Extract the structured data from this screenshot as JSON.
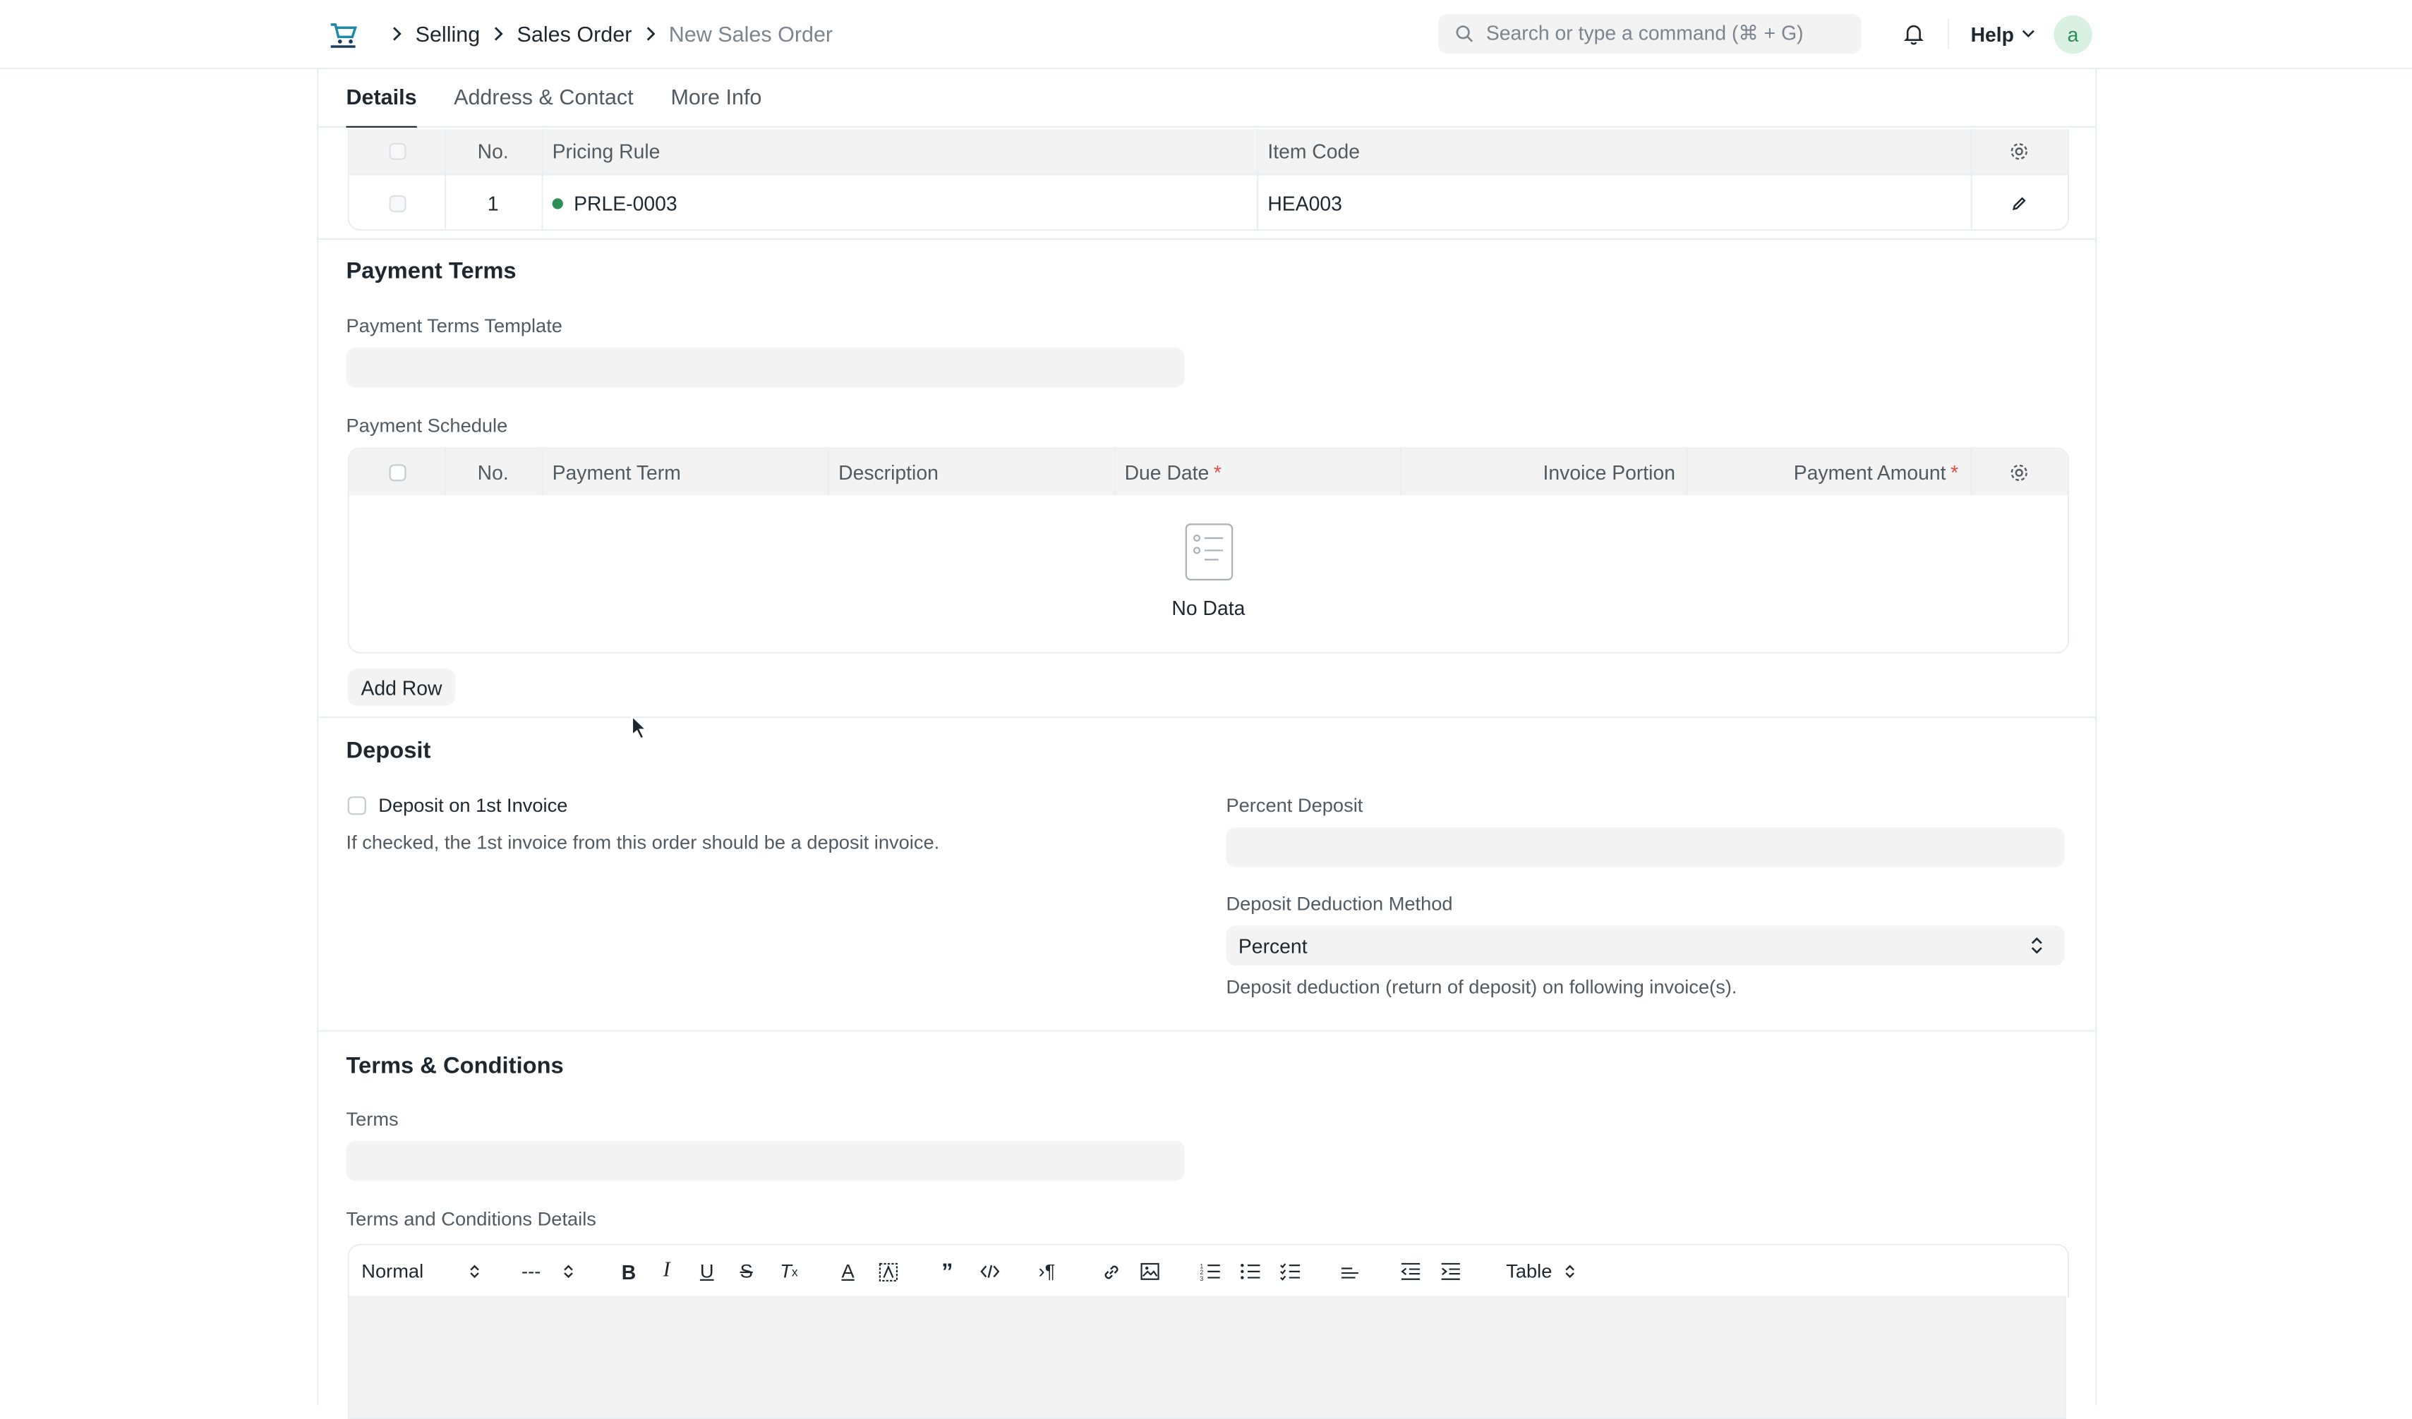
{
  "navbar": {
    "breadcrumbs": [
      "Selling",
      "Sales Order",
      "New Sales Order"
    ],
    "search_placeholder": "Search or type a command (⌘ + G)",
    "help_label": "Help",
    "avatar_initial": "a"
  },
  "tabs": [
    "Details",
    "Address & Contact",
    "More Info"
  ],
  "pricing_rules": {
    "columns": [
      "No.",
      "Pricing Rule",
      "Item Code"
    ],
    "rows": [
      {
        "no": "1",
        "pricing_rule": "PRLE-0003",
        "item_code": "HEA003"
      }
    ]
  },
  "payment_terms": {
    "title": "Payment Terms",
    "template_label": "Payment Terms Template",
    "schedule_label": "Payment Schedule",
    "columns": [
      "No.",
      "Payment Term",
      "Description",
      "Due Date",
      "Invoice Portion",
      "Payment Amount"
    ],
    "no_data": "No Data",
    "add_row": "Add Row"
  },
  "deposit": {
    "title": "Deposit",
    "checkbox_label": "Deposit on 1st Invoice",
    "checkbox_help": "If checked, the 1st invoice from this order should be a deposit invoice.",
    "percent_label": "Percent Deposit",
    "method_label": "Deposit Deduction Method",
    "method_value": "Percent",
    "method_help": "Deposit deduction (return of deposit) on following invoice(s)."
  },
  "terms": {
    "title": "Terms & Conditions",
    "terms_label": "Terms",
    "details_label": "Terms and Conditions Details",
    "toolbar": {
      "style": "Normal",
      "size": "---",
      "table": "Table"
    }
  },
  "colors": {
    "accent": "#1f272e",
    "status_green": "#2c8d57",
    "required": "#e24c4c"
  }
}
